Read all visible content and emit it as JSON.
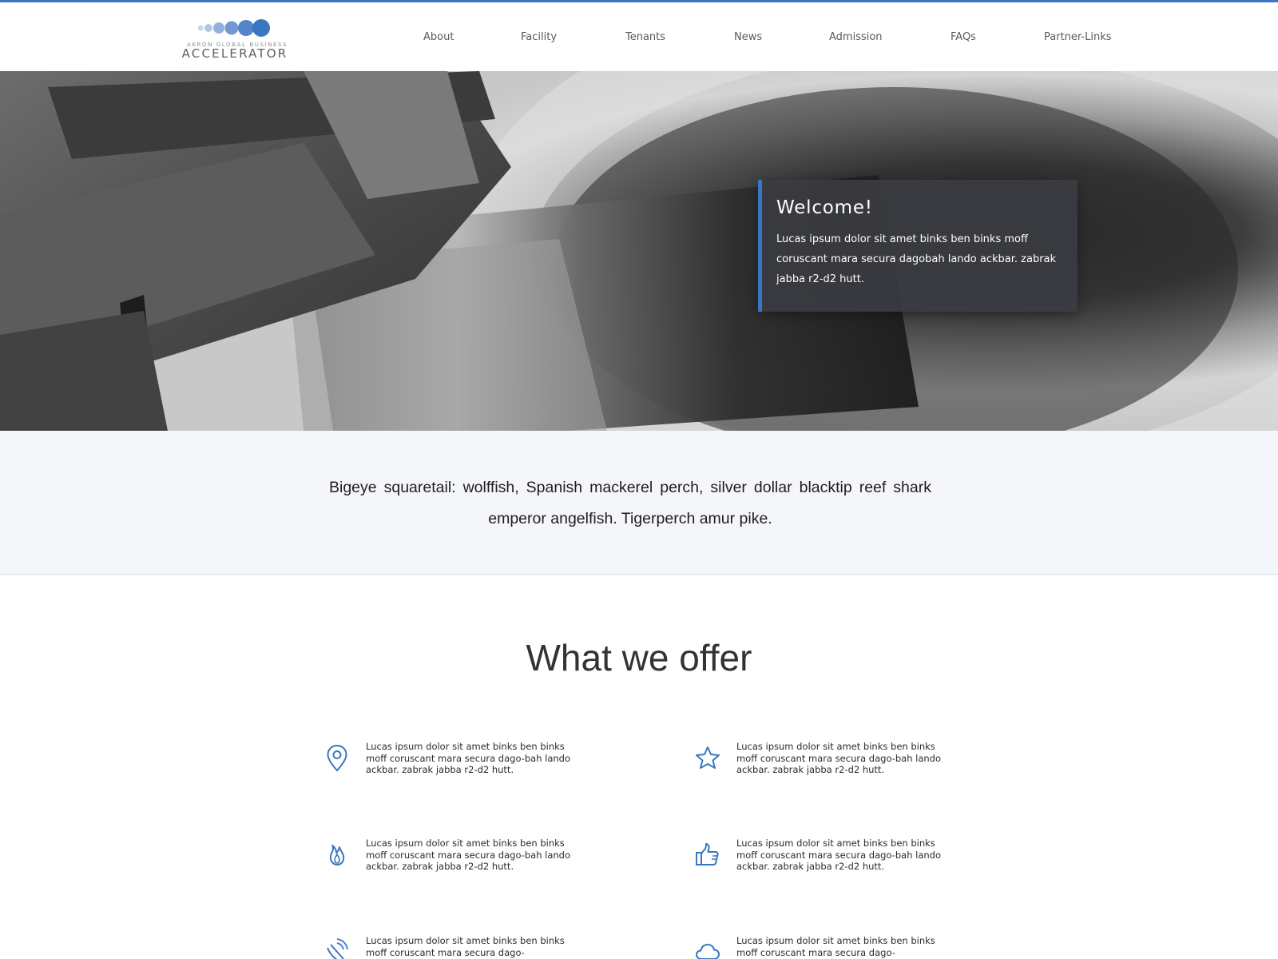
{
  "header": {
    "logo": {
      "subtitle": "AKRON GLOBAL BUSINESS",
      "title": "ACCELERATOR"
    },
    "nav": [
      {
        "label": "About"
      },
      {
        "label": "Facility"
      },
      {
        "label": "Tenants"
      },
      {
        "label": "News"
      },
      {
        "label": "Admission"
      },
      {
        "label": "FAQs"
      },
      {
        "label": "Partner-Links"
      }
    ]
  },
  "hero": {
    "welcome_title": "Welcome!",
    "welcome_text": "Lucas ipsum dolor sit amet binks ben binks moff coruscant mara secura dagobah lando ackbar. zabrak jabba r2-d2 hutt."
  },
  "tagline": "Bigeye squaretail: wolffish, Spanish mackerel perch, silver dollar blacktip reef shark emperor angelfish. Tigerperch amur pike.",
  "offer": {
    "title": "What we offer",
    "features": [
      {
        "icon": "location-pin-icon",
        "text": "Lucas ipsum dolor sit amet binks ben binks moff coruscant mara secura dago-bah lando ackbar. zabrak jabba r2-d2 hutt."
      },
      {
        "icon": "star-icon",
        "text": "Lucas ipsum dolor sit amet binks ben binks moff coruscant mara secura dago-bah lando ackbar. zabrak jabba r2-d2 hutt."
      },
      {
        "icon": "flame-icon",
        "text": "Lucas ipsum dolor sit amet binks ben binks moff coruscant mara secura dago-bah lando ackbar. zabrak jabba r2-d2 hutt."
      },
      {
        "icon": "thumbs-up-icon",
        "text": "Lucas ipsum dolor sit amet binks ben binks moff coruscant mara secura dago-bah lando ackbar. zabrak jabba r2-d2 hutt."
      },
      {
        "icon": "satellite-dish-icon",
        "text": "Lucas ipsum dolor sit amet binks ben binks moff coruscant mara secura dago-"
      },
      {
        "icon": "cloud-icon",
        "text": "Lucas ipsum dolor sit amet binks ben binks moff coruscant mara secura dago-"
      }
    ]
  },
  "colors": {
    "accent": "#3a77c2",
    "band": "#f4f6f9",
    "welcome_bg": "#3a3c42"
  }
}
